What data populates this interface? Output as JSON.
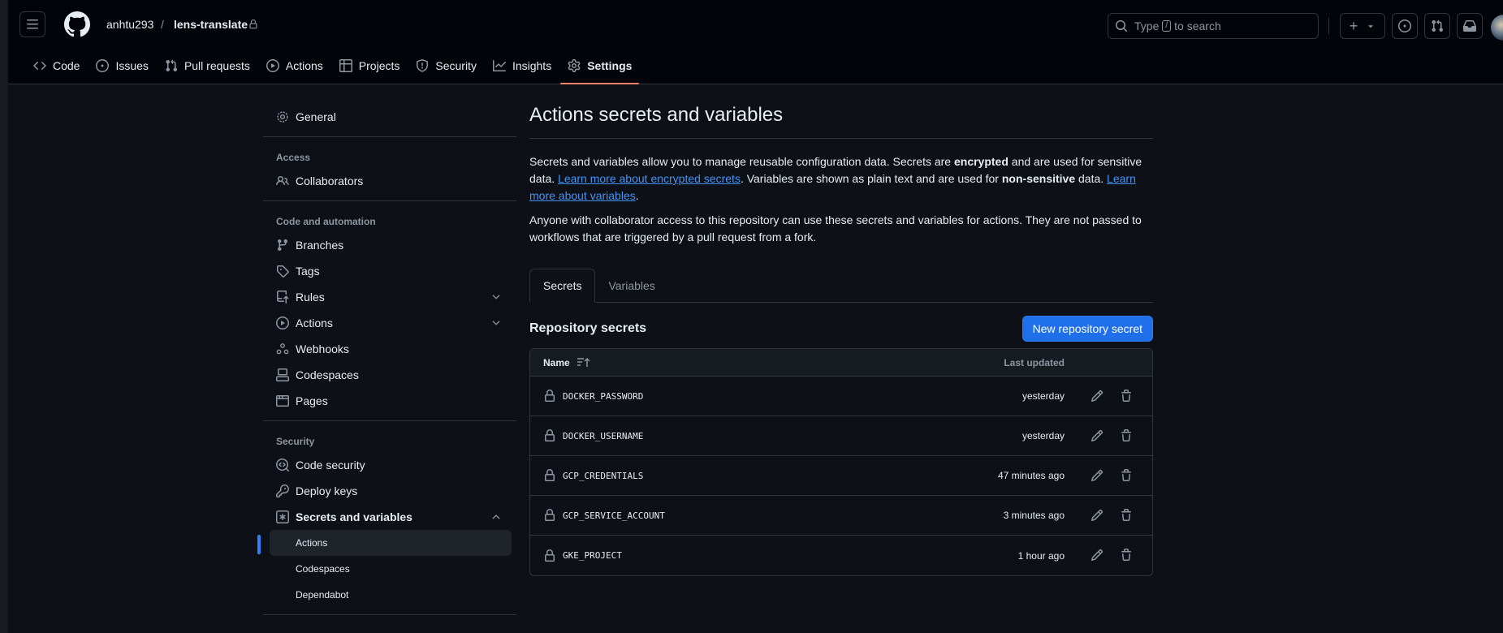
{
  "header": {
    "owner": "anhtu293",
    "separator": "/",
    "repo": "lens-translate",
    "search_prefix": "Type",
    "search_key": "/",
    "search_suffix": "to search",
    "plus_label": "+"
  },
  "nav": {
    "tabs": [
      {
        "label": "Code",
        "icon": "code-icon"
      },
      {
        "label": "Issues",
        "icon": "issue-icon"
      },
      {
        "label": "Pull requests",
        "icon": "pull-request-icon"
      },
      {
        "label": "Actions",
        "icon": "play-icon"
      },
      {
        "label": "Projects",
        "icon": "table-icon"
      },
      {
        "label": "Security",
        "icon": "shield-icon"
      },
      {
        "label": "Insights",
        "icon": "graph-icon"
      },
      {
        "label": "Settings",
        "icon": "gear-icon",
        "active": true
      }
    ]
  },
  "sidebar": {
    "general": "General",
    "access_heading": "Access",
    "collaborators": "Collaborators",
    "code_heading": "Code and automation",
    "branches": "Branches",
    "tags": "Tags",
    "rules": "Rules",
    "actions": "Actions",
    "webhooks": "Webhooks",
    "codespaces": "Codespaces",
    "pages": "Pages",
    "security_heading": "Security",
    "code_security": "Code security",
    "deploy_keys": "Deploy keys",
    "secrets_vars": "Secrets and variables",
    "sub_actions": "Actions",
    "sub_codespaces": "Codespaces",
    "sub_dependabot": "Dependabot"
  },
  "main": {
    "title": "Actions secrets and variables",
    "desc_1": "Secrets and variables allow you to manage reusable configuration data. Secrets are ",
    "desc_bold_1": "encrypted",
    "desc_2": " and are used for sensitive data. ",
    "link_1": "Learn more about encrypted secrets",
    "desc_3": ". Variables are shown as plain text and are used for ",
    "desc_bold_2": "non-sensitive",
    "desc_4": " data. ",
    "link_2": "Learn more about variables",
    "desc_5": ".",
    "desc_para2": "Anyone with collaborator access to this repository can use these secrets and variables for actions. They are not passed to workflows that are triggered by a pull request from a fork.",
    "tab_secrets": "Secrets",
    "tab_variables": "Variables",
    "section_title": "Repository secrets",
    "new_button": "New repository secret",
    "col_name": "Name",
    "col_updated": "Last updated",
    "secrets": [
      {
        "name": "DOCKER_PASSWORD",
        "updated": "yesterday"
      },
      {
        "name": "DOCKER_USERNAME",
        "updated": "yesterday"
      },
      {
        "name": "GCP_CREDENTIALS",
        "updated": "47 minutes ago"
      },
      {
        "name": "GCP_SERVICE_ACCOUNT",
        "updated": "3 minutes ago"
      },
      {
        "name": "GKE_PROJECT",
        "updated": "1 hour ago"
      }
    ]
  },
  "colors": {
    "accent": "#1f6feb",
    "link": "#4493f8",
    "tab_underline": "#f78166",
    "background": "#0d1117"
  }
}
